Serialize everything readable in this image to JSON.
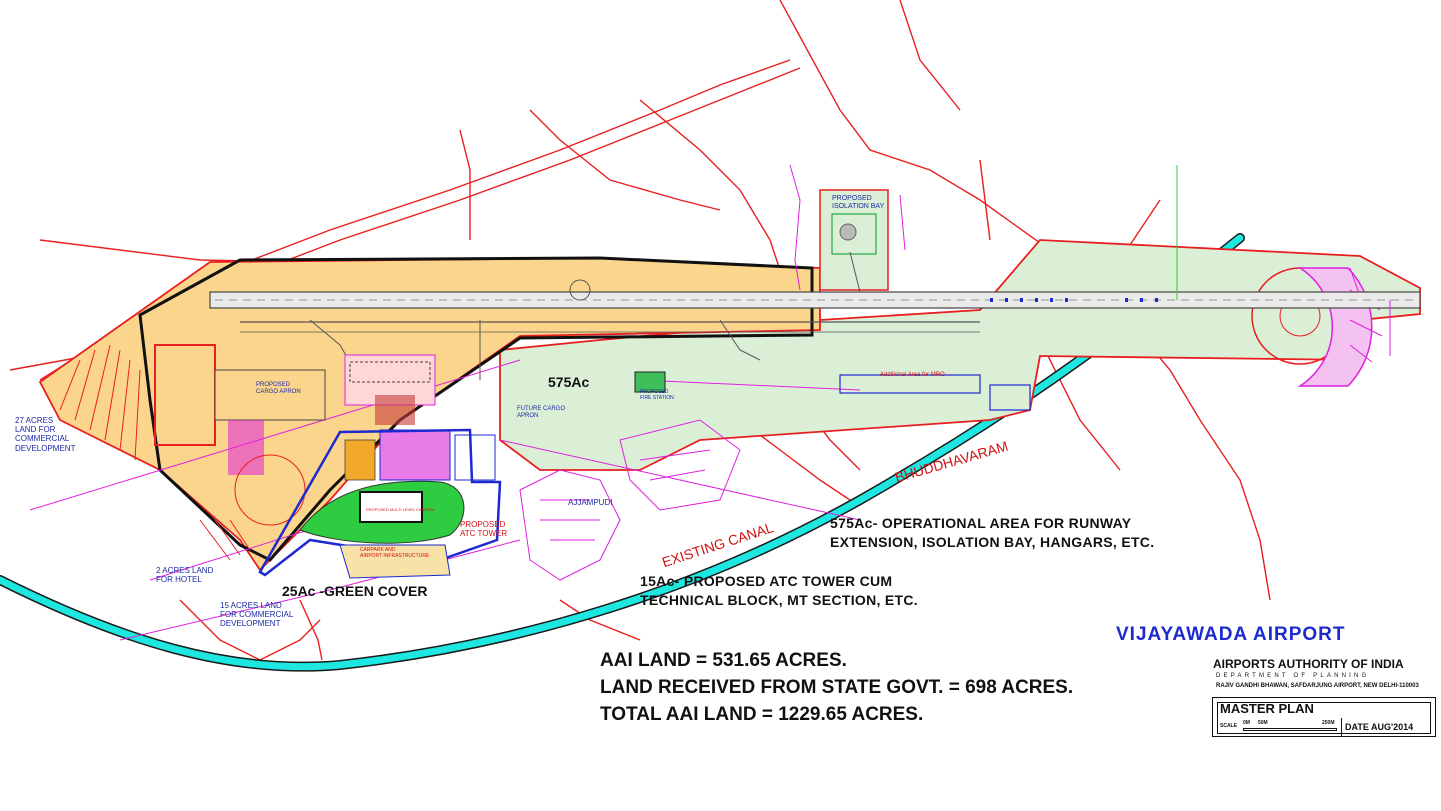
{
  "title_block": {
    "airport_name": "VIJAYAWADA AIRPORT",
    "authority": "AIRPORTS AUTHORITY OF INDIA",
    "department": "DEPARTMENT OF PLANNING",
    "address": "RAJIV GANDHI BHAWAN, SAFDARJUNG AIRPORT, NEW DELHI-110003",
    "drawing_title": "MASTER PLAN",
    "scale_label": "SCALE",
    "scale_ticks": [
      "0M",
      "50M",
      "250M"
    ],
    "date": "DATE  AUG'2014"
  },
  "land_summary": [
    "AAI LAND = 531.65 ACRES.",
    "LAND RECEIVED FROM STATE GOVT. = 698 ACRES.",
    "TOTAL AAI LAND = 1229.65 ACRES."
  ],
  "annotations": {
    "operational_area": [
      "575Ac- OPERATIONAL AREA FOR RUNWAY",
      "EXTENSION, ISOLATION BAY, HANGARS, ETC."
    ],
    "atc_tower": [
      "15Ac- PROPOSED ATC TOWER CUM",
      "TECHNICAL BLOCK, MT SECTION, ETC."
    ],
    "green_cover": "25Ac -GREEN COVER",
    "area_575": "575Ac"
  },
  "place_labels": {
    "buddhavaram": "BHUDDHAVARAM",
    "existing_canal": "EXISTING CANAL",
    "ajjampudi": "AJJAMPUDI"
  },
  "left_notes": {
    "commercial_27": [
      "27 ACRES",
      "LAND FOR",
      "COMMERCIAL",
      "DEVELOPMENT"
    ],
    "hotel_2": [
      "2 ACRES LAND",
      "FOR HOTEL"
    ],
    "commercial_15": [
      "15 ACRES LAND",
      "FOR COMMERCIAL",
      "DEVELOPMENT"
    ]
  },
  "map_labels": {
    "isolation_bay": [
      "PROPOSED",
      "ISOLATION BAY"
    ],
    "cargo_apron": [
      "PROPOSED",
      "CARGO APRON"
    ],
    "atc_tower_site": [
      "PROPOSED",
      "ATC TOWER"
    ],
    "future_cargo": [
      "FUTURE CARGO",
      "APRON"
    ],
    "mro_area": "Additional Area for MRO",
    "fire_station": [
      "PROPOSED",
      "FIRE STATION"
    ],
    "carpark": [
      "CARPARK AND",
      "AIRPORT INFRASTRUCTURE"
    ],
    "multilevel_carpark": "PROPOSED MULTI LEVEL CARPARK"
  },
  "colors": {
    "boundary_red": "#e81f1f",
    "canal_cyan": "#1ee6e0",
    "magenta": "#e020e0",
    "land_orange": "#fcd58c",
    "operational_green": "#dbeed6",
    "green_cover": "#2ecc40",
    "boundary_blue": "#1c2ad0"
  }
}
